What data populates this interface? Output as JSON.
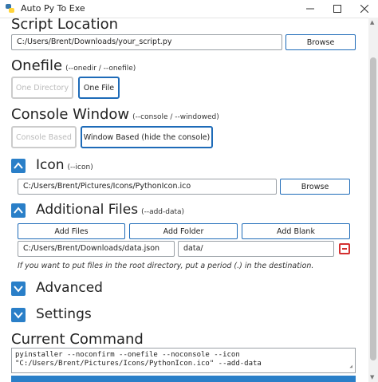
{
  "window": {
    "title": "Auto Py To Exe"
  },
  "script_location": {
    "heading": "Script Location",
    "value": "C:/Users/Brent/Downloads/your_script.py",
    "browse_label": "Browse"
  },
  "onefile": {
    "heading": "Onefile",
    "hint": "(--onedir / --onefile)",
    "option_dir": "One Directory",
    "option_file": "One File",
    "selected": "One File"
  },
  "console": {
    "heading": "Console Window",
    "hint": "(--console / --windowed)",
    "option_console": "Console Based",
    "option_window": "Window Based (hide the console)",
    "selected": "Window Based (hide the console)"
  },
  "icon_section": {
    "label": "Icon",
    "hint": "(--icon)",
    "value": "C:/Users/Brent/Pictures/Icons/PythonIcon.ico",
    "browse_label": "Browse"
  },
  "additional_files": {
    "label": "Additional Files",
    "hint": "(--add-data)",
    "add_files": "Add Files",
    "add_folder": "Add Folder",
    "add_blank": "Add Blank",
    "source": "C:/Users/Brent/Downloads/data.json",
    "destination": "data/",
    "note": "If you want to put files in the root directory, put a period (.) in the destination."
  },
  "advanced": {
    "label": "Advanced"
  },
  "settings": {
    "label": "Settings"
  },
  "current_command": {
    "heading": "Current Command",
    "line1": "pyinstaller --noconfirm --onefile --noconsole --icon",
    "line2": "\"C:/Users/Brent/Pictures/Icons/PythonIcon.ico\" --add-data"
  },
  "colors": {
    "accent": "#2a7fc8",
    "border_accent": "#1e6bb8",
    "remove": "#d32f2f"
  }
}
